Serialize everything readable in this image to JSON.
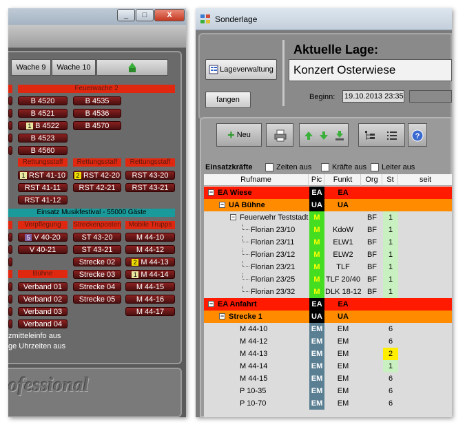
{
  "left_window": {
    "title_buttons": {
      "minimize": "_",
      "maximize": "□",
      "close": "X"
    },
    "tabs": [
      "Wache 9",
      "Wache 10"
    ],
    "feuerwache_header": "Feuerwache 2",
    "col1": [
      "B 4520",
      "B 4521",
      "B 4522",
      "B 4523",
      "B 4560"
    ],
    "col2": [
      "B 4535",
      "B 4536",
      "B 4570"
    ],
    "b4522_badge": "1",
    "rettung_headers": [
      "Rettungsstaff",
      "Rettungsstaff",
      "Rettungsstaff"
    ],
    "rst_col1": [
      "RST 41-10",
      "RST 41-11",
      "RST 41-12"
    ],
    "rst_col2": [
      "RST 42-20",
      "RST 42-21"
    ],
    "rst_col3": [
      "RST 43-20",
      "RST 43-21"
    ],
    "rst4110_badge": "1",
    "rst4220_badge": "2",
    "event_banner": "Einsatz Musikfestival - 55000 Gäste",
    "group_headers": [
      "Verpflegung",
      "Streckenposten",
      "Mobile Trupps"
    ],
    "verpf": [
      "V 40-20",
      "V 40-21"
    ],
    "verpf_badge": "5",
    "strecke_col": [
      "ST 43-20",
      "ST 43-21",
      "Strecke 02",
      "Strecke 03",
      "Strecke 04",
      "Strecke 05"
    ],
    "mobile_col": [
      "M 44-10",
      "M 44-12",
      "M 44-13",
      "M 44-14",
      "M 44-15",
      "M 44-16",
      "M 44-17"
    ],
    "m4413_badge": "2",
    "m4414_badge": "1",
    "buehne_header": "Bühne",
    "verband": [
      "Verband 01",
      "Verband 02",
      "Verband 03",
      "Verband 04"
    ],
    "options": [
      "zmitteleinfo aus",
      "ge Uhrzeiten aus"
    ],
    "watermark": "ofessional"
  },
  "right_window": {
    "title": "Sonderlage",
    "lageverwaltung_button": "Lageverwaltung",
    "fangen_button": "fangen",
    "aktuelle_lage_label": "Aktuelle Lage:",
    "lage_name": "Konzert Osterwiese",
    "beginn_label": "Beginn:",
    "beginn_value": "19.10.2013 23:35",
    "neu_button": "Neu",
    "einsatzkraefte_label": "Einsatzkräfte",
    "checkboxes": [
      "Zeiten aus",
      "Kräfte aus",
      "Leiter aus"
    ],
    "columns": {
      "rufname": "Rufname",
      "pic": "Pic",
      "funkt": "Funkt",
      "org": "Org",
      "st": "St",
      "seit": "seit"
    },
    "rows": [
      {
        "name": "EA Wiese",
        "pic": "EA",
        "funkt": "EA",
        "org": "",
        "st": ""
      },
      {
        "name": "UA Bühne",
        "pic": "UA",
        "funkt": "UA",
        "org": "",
        "st": ""
      },
      {
        "name": "Feuerwehr Teststadt",
        "pic": "M",
        "funkt": "",
        "org": "BF",
        "st": "1"
      },
      {
        "name": "Florian 23/10",
        "pic": "M",
        "funkt": "KdoW",
        "org": "BF",
        "st": "1"
      },
      {
        "name": "Florian 23/11",
        "pic": "M",
        "funkt": "ELW1",
        "org": "BF",
        "st": "1"
      },
      {
        "name": "Florian 23/12",
        "pic": "M",
        "funkt": "ELW2",
        "org": "BF",
        "st": "1"
      },
      {
        "name": "Florian 23/21",
        "pic": "M",
        "funkt": "TLF",
        "org": "BF",
        "st": "1"
      },
      {
        "name": "Florian 23/25",
        "pic": "M",
        "funkt": "TLF 20/40",
        "org": "BF",
        "st": "1"
      },
      {
        "name": "Florian 23/32",
        "pic": "M",
        "funkt": "DLK 18-12",
        "org": "BF",
        "st": "1"
      },
      {
        "name": "EA Anfahrt",
        "pic": "EA",
        "funkt": "EA",
        "org": "",
        "st": ""
      },
      {
        "name": "Strecke 1",
        "pic": "UA",
        "funkt": "UA",
        "org": "",
        "st": ""
      },
      {
        "name": "M 44-10",
        "pic": "EM",
        "funkt": "EM",
        "org": "",
        "st": "6"
      },
      {
        "name": "M 44-12",
        "pic": "EM",
        "funkt": "EM",
        "org": "",
        "st": "6"
      },
      {
        "name": "M 44-13",
        "pic": "EM",
        "funkt": "EM",
        "org": "",
        "st": "2"
      },
      {
        "name": "M 44-14",
        "pic": "EM",
        "funkt": "EM",
        "org": "",
        "st": "1"
      },
      {
        "name": "M 44-15",
        "pic": "EM",
        "funkt": "EM",
        "org": "",
        "st": "6"
      },
      {
        "name": "P 10-35",
        "pic": "EM",
        "funkt": "EM",
        "org": "",
        "st": "6"
      },
      {
        "name": "P 10-70",
        "pic": "EM",
        "funkt": "EM",
        "org": "",
        "st": "6"
      }
    ]
  },
  "colors": {
    "red": "#ff1a00",
    "orange": "#ff8c00",
    "green": "#44dd22",
    "yellow": "#ffee00",
    "lightgreen": "#c8f0c0"
  }
}
